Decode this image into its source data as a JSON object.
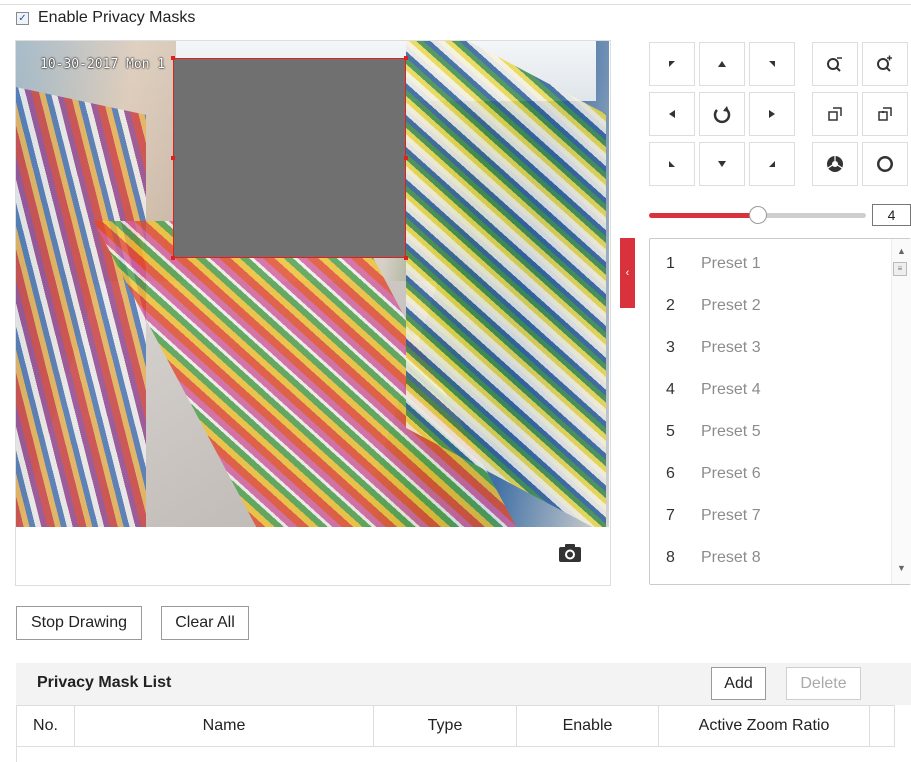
{
  "privacy": {
    "enable_label": "Enable Privacy Masks",
    "enabled": true
  },
  "video": {
    "timestamp": "10-30-2017 Mon 1"
  },
  "ptz": {
    "speed_value": "4",
    "speed_fraction": 0.5,
    "buttons": [
      "pan-up-left-icon",
      "pan-up-icon",
      "pan-up-right-icon",
      "zoom-out-icon",
      "zoom-in-icon",
      "pan-left-icon",
      "auto-pan-icon",
      "pan-right-icon",
      "focus-near-icon",
      "focus-far-icon",
      "pan-down-left-icon",
      "pan-down-icon",
      "pan-down-right-icon",
      "iris-close-icon",
      "iris-open-icon"
    ]
  },
  "presets": [
    {
      "num": "1",
      "name": "Preset 1"
    },
    {
      "num": "2",
      "name": "Preset 2"
    },
    {
      "num": "3",
      "name": "Preset 3"
    },
    {
      "num": "4",
      "name": "Preset 4"
    },
    {
      "num": "5",
      "name": "Preset 5"
    },
    {
      "num": "6",
      "name": "Preset 6"
    },
    {
      "num": "7",
      "name": "Preset 7"
    },
    {
      "num": "8",
      "name": "Preset 8"
    }
  ],
  "actions": {
    "stop_drawing": "Stop Drawing",
    "clear_all": "Clear All"
  },
  "mask_list": {
    "title": "Privacy Mask List",
    "add": "Add",
    "delete": "Delete",
    "columns": [
      "No.",
      "Name",
      "Type",
      "Enable",
      "Active Zoom Ratio"
    ]
  },
  "colors": {
    "accent": "#d9323d",
    "mask_fill": "#707070",
    "mask_border": "#e02020"
  }
}
